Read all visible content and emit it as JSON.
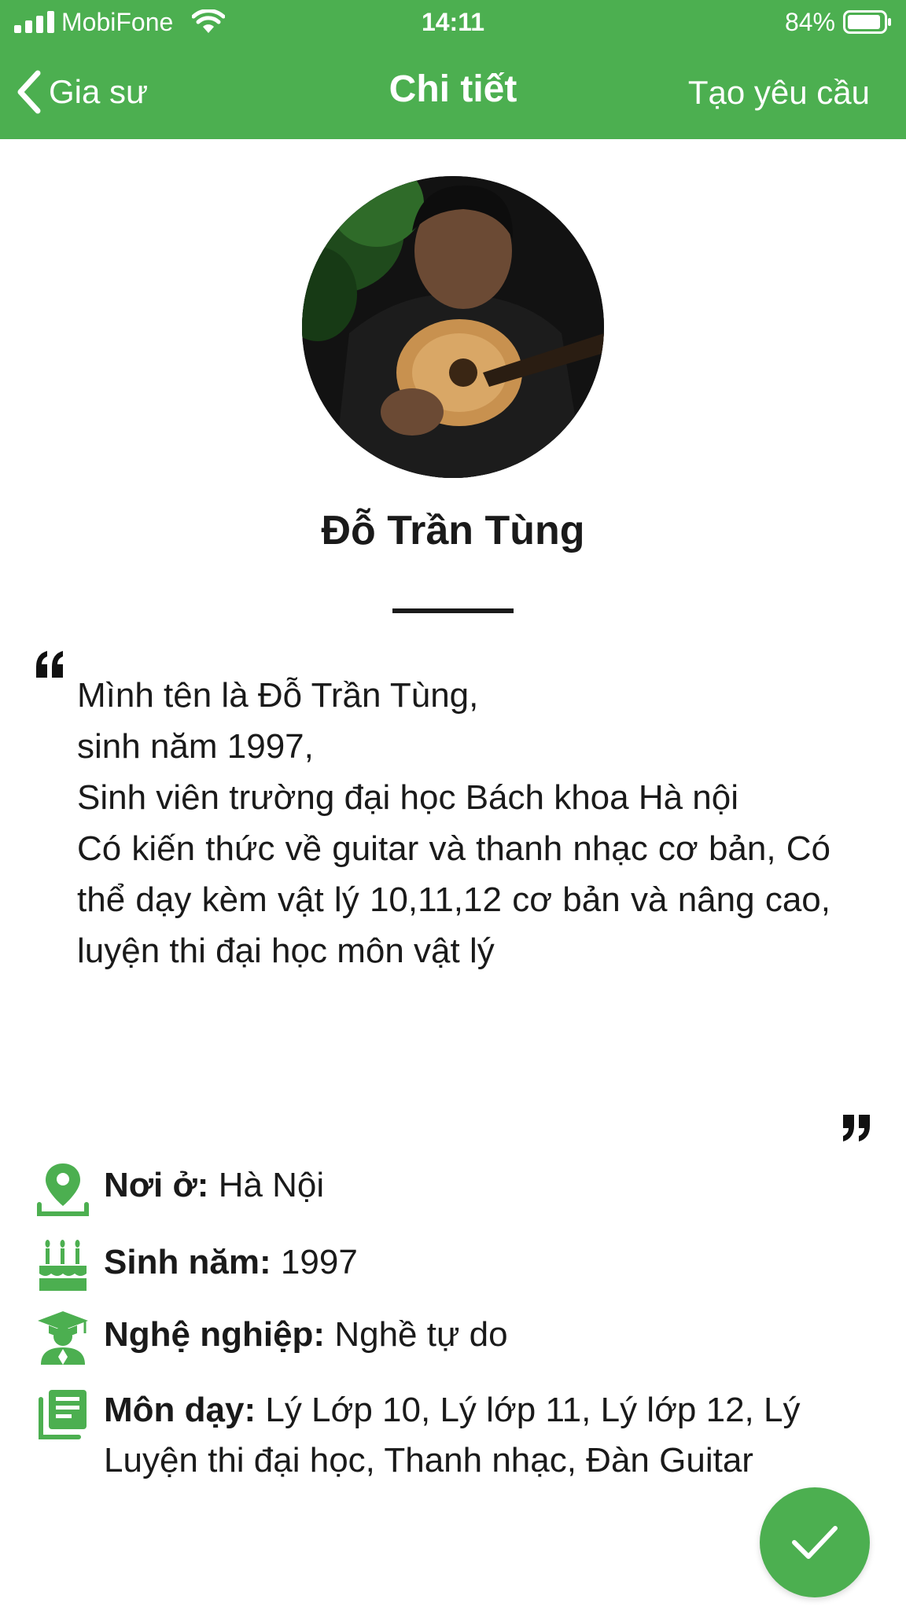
{
  "status_bar": {
    "carrier": "MobiFone",
    "time": "14:11",
    "battery_percent": "84%"
  },
  "nav": {
    "back_label": "Gia sư",
    "title": "Chi tiết",
    "action_label": "Tạo yêu cầu"
  },
  "profile": {
    "name": "Đỗ Trần Tùng",
    "bio_lines": [
      "Mình tên là Đỗ Trần Tùng,",
      "sinh năm 1997,",
      "Sinh viên trường đại học Bách khoa Hà nội",
      "Có kiến thức về guitar và thanh nhạc cơ bản, Có thể dạy kèm vật lý 10,11,12 cơ bản và nâng cao, luyện thi đại học môn vật lý"
    ]
  },
  "info": {
    "residence": {
      "label": "Nơi ở:",
      "value": "Hà Nội"
    },
    "birth_year": {
      "label": "Sinh năm:",
      "value": "1997"
    },
    "occupation": {
      "label": "Nghệ nghiệp:",
      "value": "Nghề tự do"
    },
    "subjects": {
      "label": "Môn dạy:",
      "value": "Lý Lớp 10, Lý lớp 11, Lý lớp 12, Lý Luyện thi đại học, Thanh nhạc, Đàn Guitar"
    }
  },
  "icons": {
    "back": "chevron-left-icon",
    "residence": "location-pin-icon",
    "birth_year": "birthday-cake-icon",
    "occupation": "graduate-icon",
    "subjects": "book-list-icon",
    "confirm": "checkmark-icon"
  },
  "colors": {
    "primary": "#4caf50",
    "text": "#1a1a1a",
    "on_primary": "#ffffff"
  }
}
